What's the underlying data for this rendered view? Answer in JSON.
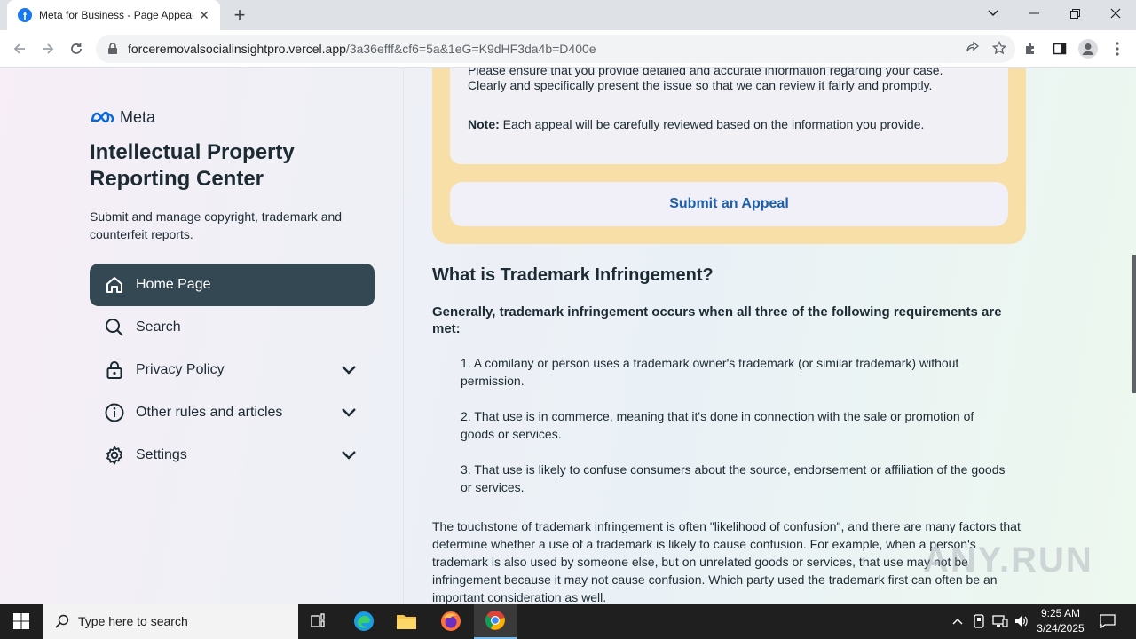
{
  "browser": {
    "tab_title": "Meta for Business - Page Appeal",
    "tab_close": "✕",
    "new_tab": "+",
    "url_host": "forceremovalsocialinsightpro.vercel.app",
    "url_path": "/3a36efff&cf6=5a&1eG=K9dHF3da4b=D400e"
  },
  "sidebar": {
    "logo_text": "Meta",
    "title": "Intellectual Property Reporting Center",
    "subtitle": "Submit and manage copyright, trademark and counterfeit reports.",
    "items": [
      {
        "label": "Home Page",
        "icon": "home-icon",
        "active": true
      },
      {
        "label": "Search",
        "icon": "search-icon"
      },
      {
        "label": "Privacy Policy",
        "icon": "lock-icon",
        "expandable": true
      },
      {
        "label": "Other rules and articles",
        "icon": "info-icon",
        "expandable": true
      },
      {
        "label": "Settings",
        "icon": "gear-icon",
        "expandable": true
      }
    ]
  },
  "appeal": {
    "line1": "Please ensure that you provide detailed and accurate information regarding your case.",
    "line2": "Clearly and specifically present the issue so that we can review it fairly and promptly.",
    "note_label": "Note:",
    "note_text": " Each appeal will be carefully reviewed based on the information you provide.",
    "button_label": "Submit an Appeal"
  },
  "article": {
    "heading": "What is Trademark Infringement?",
    "intro": "Generally, trademark infringement occurs when all three of the following requirements are met:",
    "requirements": [
      "1. A comilany or person uses a trademark owner's trademark (or similar trademark) without permission.",
      "2. That use is in commerce, meaning that it's done in connection with the sale or promotion of goods or services.",
      "3. That use is likely to confuse consumers about the source, endorsement or affiliation of the goods or services."
    ],
    "paragraph": "The touchstone of trademark infringement is often \"likelihood of confusion\", and there are many factors that determine whether a use of a trademark is likely to cause confusion. For example, when a person's trademark is also used by someone else, but on unrelated goods or services, that use may not be infringement because it may not cause confusion. Which party used the trademark first can often be an important consideration as well."
  },
  "watermark": "ANY.RUN",
  "taskbar": {
    "search_placeholder": "Type here to search",
    "time": "9:25 AM",
    "date": "3/24/2025"
  },
  "colors": {
    "accent_nav": "#344854",
    "appeal_box": "#f8dfa8",
    "link_blue": "#1d5fa8",
    "facebook_blue": "#1877f2"
  }
}
